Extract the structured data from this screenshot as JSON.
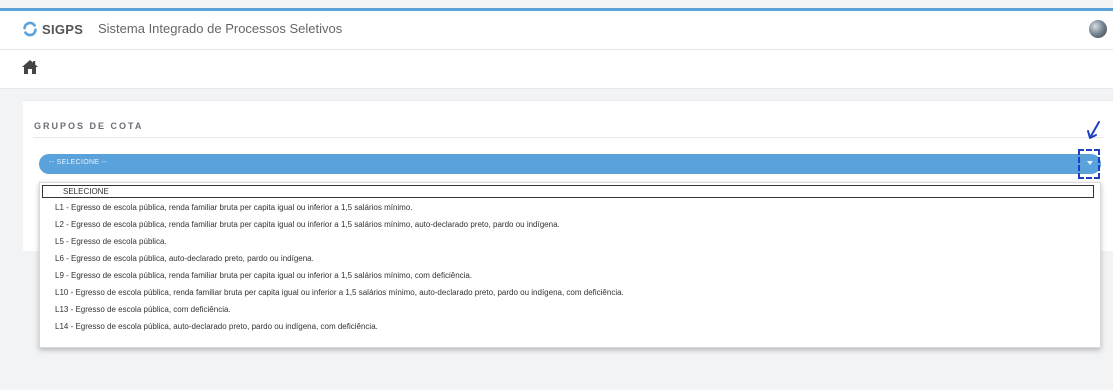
{
  "header": {
    "logo_text": "SIGPS",
    "app_name": "Sistema Integrado de Processos Seletivos"
  },
  "panel": {
    "title": "GRUPOS DE COTA"
  },
  "select": {
    "value": "-- SELECIONE --"
  },
  "dropdown": {
    "options": [
      "SELECIONE",
      "L1 - Egresso de escola pública, renda familiar bruta per capita igual ou inferior a 1,5 salários mínimo.",
      "L2 - Egresso de escola pública, renda familiar bruta per capita igual ou inferior a 1,5 salários mínimo, auto-declarado preto, pardo ou indígena.",
      "L5 - Egresso de escola pública.",
      "L6 - Egresso de escola pública, auto-declarado preto, pardo ou indígena.",
      "L9 - Egresso de escola pública, renda familiar bruta per capita igual ou inferior a 1,5 salários mínimo, com deficiência.",
      "L10 - Egresso de escola pública, renda familiar bruta per capita igual ou inferior a 1,5 salários mínimo, auto-declarado preto, pardo ou indígena, com deficiência.",
      "L13 - Egresso de escola pública, com deficiência.",
      "L14 - Egresso de escola pública, auto-declarado preto, pardo ou indígena, com deficiência."
    ]
  },
  "colors": {
    "accent": "#5aa2dc",
    "annotation": "#1f3ec6"
  },
  "icons": [
    "sigps-logo-icon",
    "avatar-globe-icon",
    "home-icon",
    "chevron-down-icon",
    "annotation-arrow-icon"
  ]
}
